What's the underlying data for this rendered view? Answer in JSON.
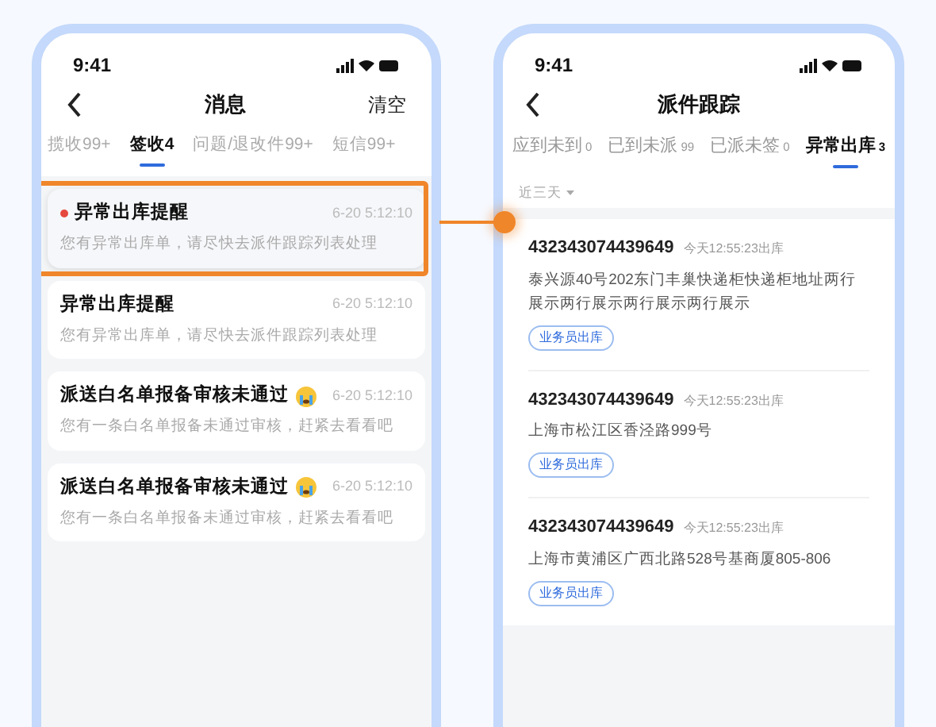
{
  "left_screen": {
    "status_time": "9:41",
    "title": "消息",
    "action": "清空",
    "tabs": [
      {
        "label": "揽收99+",
        "selected": false
      },
      {
        "label": "签收4",
        "selected": true
      },
      {
        "label": "问题/退改件99+",
        "selected": false
      },
      {
        "label": "短信99+",
        "selected": false
      }
    ],
    "messages": [
      {
        "title": "异常出库提醒",
        "unread": true,
        "emoji": false,
        "highlighted": true,
        "time": "6-20 5:12:10",
        "body": "您有异常出库单，请尽快去派件跟踪列表处理"
      },
      {
        "title": "异常出库提醒",
        "unread": false,
        "emoji": false,
        "highlighted": false,
        "time": "6-20 5:12:10",
        "body": "您有异常出库单，请尽快去派件跟踪列表处理"
      },
      {
        "title": "派送白名单报备审核未通过",
        "unread": false,
        "emoji": true,
        "highlighted": false,
        "time": "6-20 5:12:10",
        "body": "您有一条白名单报备未通过审核，赶紧去看看吧"
      },
      {
        "title": "派送白名单报备审核未通过",
        "unread": false,
        "emoji": true,
        "highlighted": false,
        "time": "6-20 5:12:10",
        "body": "您有一条白名单报备未通过审核，赶紧去看看吧"
      }
    ]
  },
  "right_screen": {
    "status_time": "9:41",
    "title": "派件跟踪",
    "tabs": [
      {
        "label": "应到未到",
        "count": "0",
        "selected": false
      },
      {
        "label": "已到未派",
        "count": "99",
        "selected": false
      },
      {
        "label": "已派未签",
        "count": "0",
        "selected": false
      },
      {
        "label": "异常出库",
        "count": "3",
        "selected": true
      }
    ],
    "filter": "近三天",
    "items": [
      {
        "number": "432343074439649",
        "time": "今天12:55:23出库",
        "address": "泰兴源40号202东门丰巢快递柜快递柜地址两行展示两行展示两行展示两行展示",
        "tag": "业务员出库"
      },
      {
        "number": "432343074439649",
        "time": "今天12:55:23出库",
        "address": "上海市松江区香泾路999号",
        "tag": "业务员出库"
      },
      {
        "number": "432343074439649",
        "time": "今天12:55:23出库",
        "address": "上海市黄浦区广西北路528号基商厦805-806",
        "tag": "业务员出库"
      }
    ]
  }
}
